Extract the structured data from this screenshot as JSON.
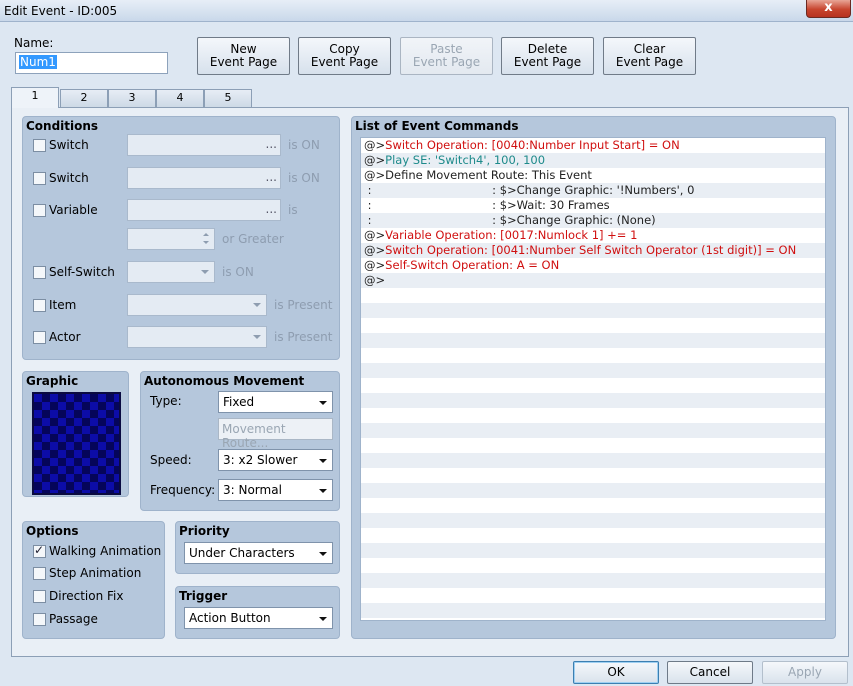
{
  "window": {
    "title": "Edit Event - ID:005",
    "close_glyph": "x"
  },
  "name": {
    "label": "Name:",
    "value": "Num1"
  },
  "toolbar": {
    "new_label": "New\nEvent Page",
    "copy_label": "Copy\nEvent Page",
    "paste_label": "Paste\nEvent Page",
    "delete_label": "Delete\nEvent Page",
    "clear_label": "Clear\nEvent Page"
  },
  "tabs": [
    "1",
    "2",
    "3",
    "4",
    "5"
  ],
  "conditions": {
    "title": "Conditions",
    "switch1": {
      "label": "Switch",
      "suffix": "is ON",
      "dots": "..."
    },
    "switch2": {
      "label": "Switch",
      "suffix": "is ON",
      "dots": "..."
    },
    "variable": {
      "label": "Variable",
      "suffix": "is",
      "dots": "...",
      "or_greater": "or Greater"
    },
    "self_switch": {
      "label": "Self-Switch",
      "suffix": "is ON"
    },
    "item": {
      "label": "Item",
      "suffix": "is Present"
    },
    "actor": {
      "label": "Actor",
      "suffix": "is Present"
    }
  },
  "graphic": {
    "title": "Graphic"
  },
  "autonomous": {
    "title": "Autonomous Movement",
    "type_label": "Type:",
    "type_value": "Fixed",
    "route_button": "Movement Route...",
    "speed_label": "Speed:",
    "speed_value": "3: x2 Slower",
    "frequency_label": "Frequency:",
    "frequency_value": "3: Normal"
  },
  "options": {
    "title": "Options",
    "walking": "Walking Animation",
    "step": "Step Animation",
    "direction": "Direction Fix",
    "passage": "Passage"
  },
  "priority": {
    "title": "Priority",
    "value": "Under Characters"
  },
  "trigger": {
    "title": "Trigger",
    "value": "Action Button"
  },
  "commands": {
    "title": "List of Event Commands",
    "rows": [
      {
        "prefix": "@>",
        "text": "Switch Operation: [0040:Number Input Start] = ON",
        "color": "red"
      },
      {
        "prefix": "@>",
        "text": "Play SE: 'Switch4', 100, 100",
        "color": "teal"
      },
      {
        "prefix": "@>",
        "text": "Define Movement Route: This Event",
        "color": "blk"
      },
      {
        "prefix": " :",
        "text": "                                 : $>Change Graphic: '!Numbers', 0",
        "color": "blk"
      },
      {
        "prefix": " :",
        "text": "                                 : $>Wait: 30 Frames",
        "color": "blk"
      },
      {
        "prefix": " :",
        "text": "                                 : $>Change Graphic: (None)",
        "color": "blk"
      },
      {
        "prefix": "@>",
        "text": "Variable Operation: [0017:Numlock 1] += 1",
        "color": "red"
      },
      {
        "prefix": "@>",
        "text": "Switch Operation: [0041:Number Self Switch Operator (1st digit)] = ON",
        "color": "red"
      },
      {
        "prefix": "@>",
        "text": "Self-Switch Operation: A = ON",
        "color": "red"
      },
      {
        "prefix": "@>",
        "text": "",
        "color": "blk"
      }
    ]
  },
  "footer": {
    "ok": "OK",
    "cancel": "Cancel",
    "apply": "Apply"
  }
}
